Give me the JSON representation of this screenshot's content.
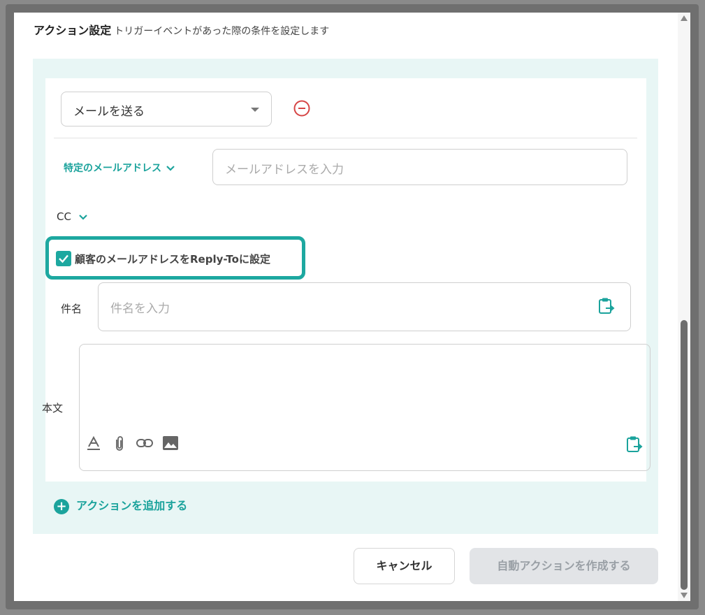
{
  "header": {
    "title": "アクション設定",
    "subtitle": "トリガーイベントがあった際の条件を設定します"
  },
  "action": {
    "type_value": "メールを送る",
    "recipient_type": "特定のメールアドレス",
    "email_placeholder": "メールアドレスを入力",
    "cc_label": "CC",
    "reply_to_label": "顧客のメールアドレスをReply-Toに設定",
    "reply_to_checked": true,
    "subject_label": "件名",
    "subject_placeholder": "件名を入力",
    "body_label": "本文",
    "toolbar_icons": [
      "text-format-icon",
      "attachment-icon",
      "link-icon",
      "image-icon"
    ]
  },
  "add_action_label": "アクションを追加する",
  "footer": {
    "cancel_label": "キャンセル",
    "create_label": "自動アクションを作成する"
  },
  "colors": {
    "accent": "#1ba39c",
    "highlight_border": "#1da8a0",
    "panel_bg": "#e8f6f5",
    "remove_red": "#d64545",
    "disabled_button_bg": "#e2e4e7"
  }
}
